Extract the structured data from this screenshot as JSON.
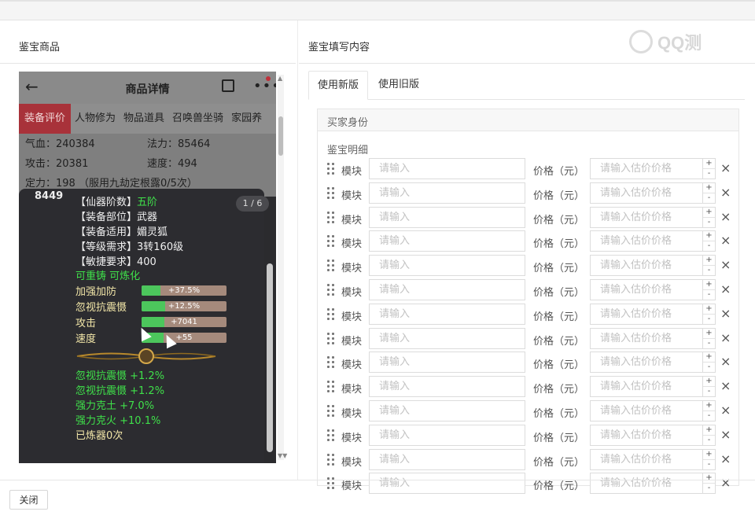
{
  "left_title": "鉴宝商品",
  "right_title": "鉴宝填写内容",
  "watermark": "QQ测",
  "phone": {
    "title": "商品详情",
    "tabs": [
      "装备评价",
      "人物修为",
      "物品道具",
      "召唤兽坐骑",
      "家园养"
    ],
    "stats": [
      {
        "label": "气血：240384"
      },
      {
        "label": "法力：85464"
      },
      {
        "label": "攻击：20381"
      },
      {
        "label": "速度：494"
      },
      {
        "label": "定力：198 （服用九劫定根露0/5次）"
      }
    ],
    "num": "8449",
    "page": "1 / 6",
    "attrs": [
      {
        "k": "【仙器阶数】",
        "v": "五阶",
        "vc": "g"
      },
      {
        "k": "【装备部位】",
        "v": "武器",
        "vc": "w"
      },
      {
        "k": "【装备适用】",
        "v": "媚灵狐",
        "vc": "w"
      },
      {
        "k": "【等级需求】",
        "v": "3转160级",
        "vc": "w"
      },
      {
        "k": "【敏捷要求】",
        "v": "400",
        "vc": "w"
      }
    ],
    "refine_text": "可重铸 可炼化",
    "bars": [
      {
        "label": "加强加防",
        "value": "+37.5%",
        "fill": 0.22
      },
      {
        "label": "忽视抗震慑",
        "value": "+12.5%",
        "fill": 0.28
      },
      {
        "label": "攻击",
        "value": "+7041",
        "fill": 0.27
      },
      {
        "label": "速度",
        "value": "+55",
        "fill": 0.26
      }
    ],
    "extras": [
      {
        "t": "忽视抗震慑 +1.2%",
        "c": "g"
      },
      {
        "t": "忽视抗震慑 +1.2%",
        "c": "g"
      },
      {
        "t": "强力克土 +7.0%",
        "c": "g"
      },
      {
        "t": "强力克火 +10.1%",
        "c": "g"
      },
      {
        "t": "已炼器0次",
        "c": "y"
      }
    ]
  },
  "tabs": {
    "new": "使用新版",
    "old": "使用旧版"
  },
  "box_head": "买家身份",
  "detail_label": "鉴宝明细",
  "row": {
    "module_label": "模块",
    "module_placeholder": "请输入",
    "price_label": "价格（元）",
    "price_placeholder": "请输入估价价格",
    "plus": "+",
    "minus": "-",
    "delete": "×"
  },
  "row_count": 14,
  "close_label": "关闭"
}
